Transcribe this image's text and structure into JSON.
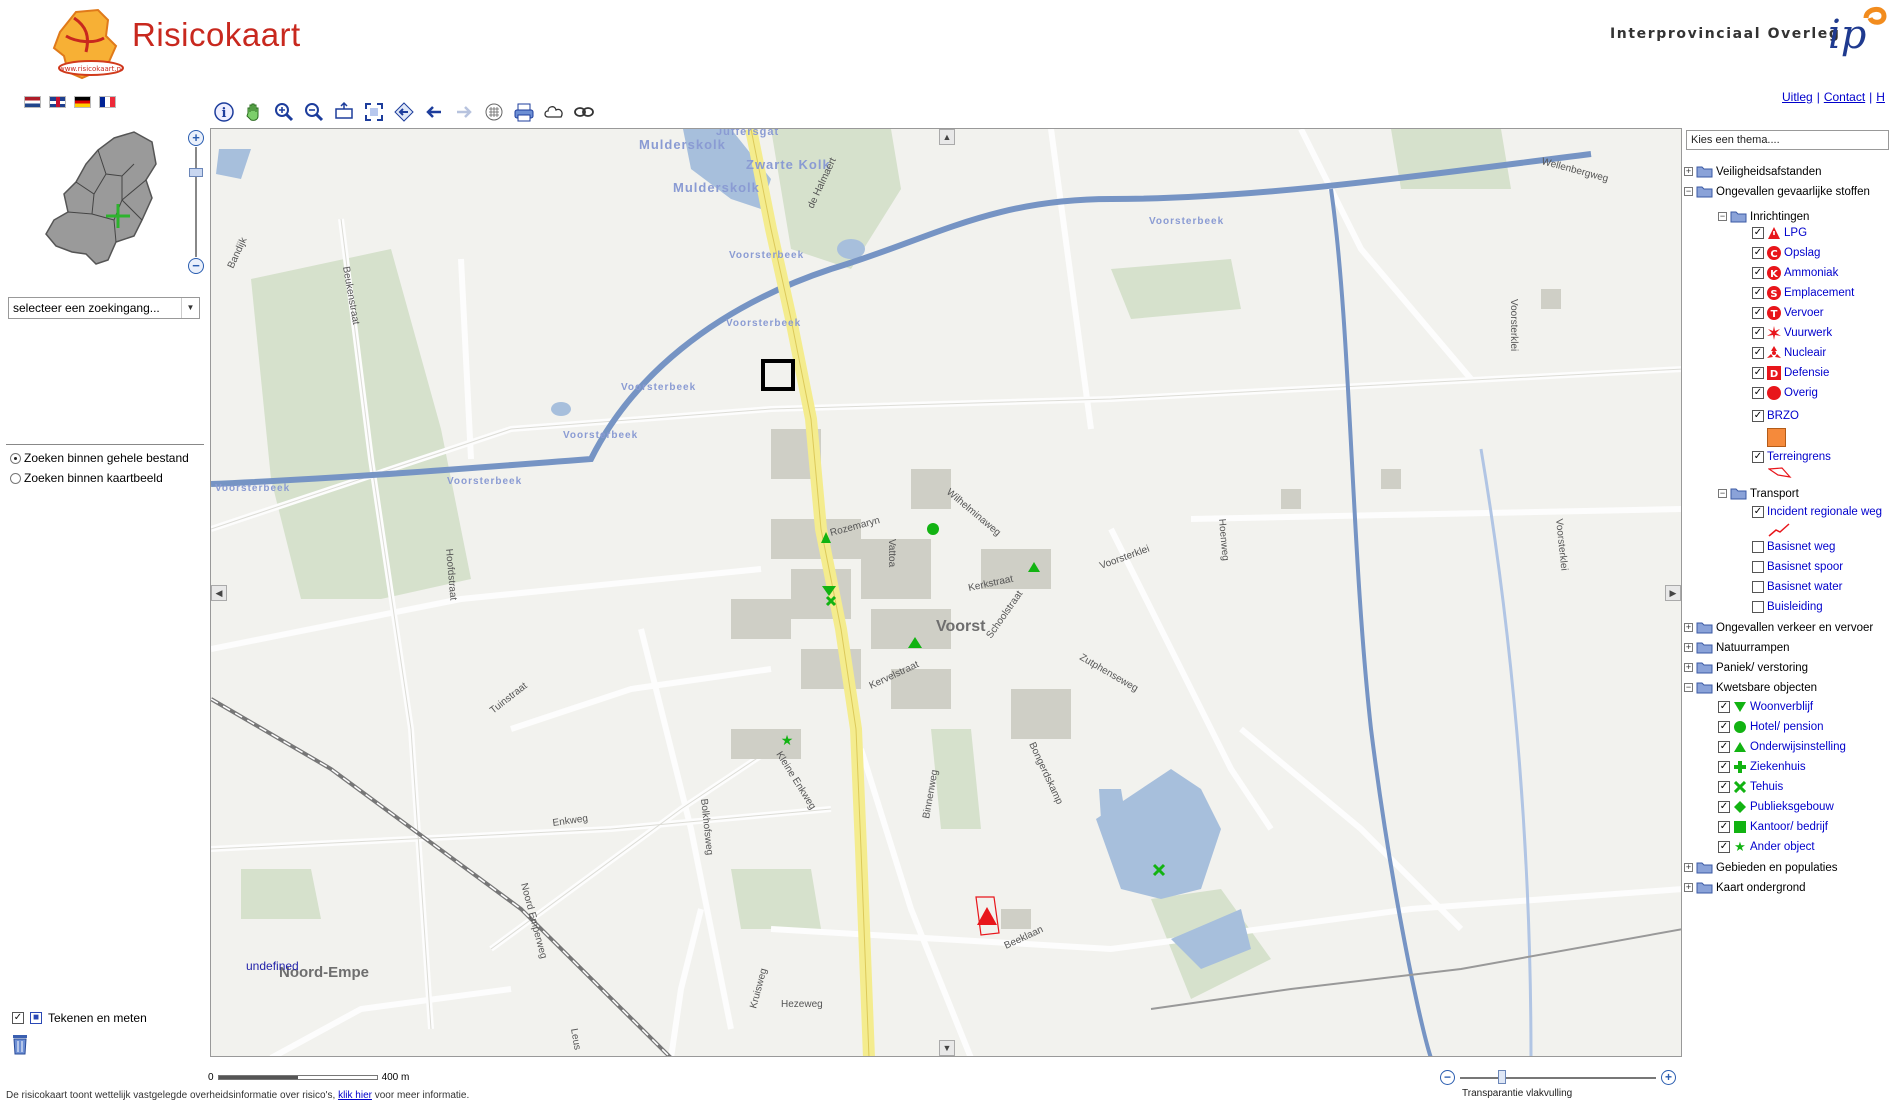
{
  "header": {
    "title": "Risicokaart",
    "logo_url_text": "www.risicokaart.nl",
    "org_name": "Interprovinciaal Overleg",
    "org_logo_text": "ip",
    "links": [
      "Uitleg",
      "Contact"
    ]
  },
  "languages": [
    "Nederlands",
    "English",
    "Deutsch",
    "Français"
  ],
  "search": {
    "dropdown_value": "selecteer  een zoekingang...",
    "options": [
      "Zoeken binnen gehele bestand",
      "Zoeken binnen kaartbeeld"
    ],
    "selected": 0
  },
  "draw": {
    "label": "Tekenen en meten"
  },
  "map": {
    "labels": {
      "undefined": "undefined",
      "jufferstgat": "Juffersgat",
      "mulderskolk1": "Mulderskolk",
      "zwarte_kolk": "Zwarte Kolk",
      "mulderskolk2": "Mulderskolk",
      "voorsterbeek": "Voorsterbeek",
      "voorst": "Voorst",
      "noord_empe": "Noord-Empe",
      "wellenbergweg": "Wellenbergweg",
      "voorsterklei": "Voorsterklei",
      "bandijk": "Bandijk",
      "beukenstraat": "Beukenstraat",
      "hoofdstraat": "Hoofdstraat",
      "tuinstraat": "Tuinstraat",
      "enkweg": "Enkweg",
      "kleine_enkweg": "Kleine Enkweg",
      "bolkhofsweg": "Bolkhofsweg",
      "noord_emperweg": "Noord Emperweg",
      "hezeweg": "Hezeweg",
      "kruisweg": "Kruisweg",
      "leus": "Leus",
      "binnenweg": "Binnenweg",
      "beeklaan": "Beeklaan",
      "bongerdskamp": "Bongerdskamp",
      "zutphenseweg": "Zutphenseweg",
      "schoolstraat": "Schoolstraat",
      "kerkstraat": "Kerkstraat",
      "wilhelminaweg": "Wilhelminaweg",
      "rozemaryn": "Rozemaryn",
      "kervelstraat": "Kervelstraat",
      "hoenweg": "Hoenweg",
      "de_halmaert": "de Halmaert",
      "vattoa": "Vattoa",
      "ewsweg": "Ewsweg"
    }
  },
  "scalebar": {
    "start": "0",
    "end": "400 m"
  },
  "transparency": {
    "label": "Transparantie vlakvulling"
  },
  "footer": {
    "text_before": "De risicokaart toont wettelijk vastgelegde overheidsinformatie over risico's,",
    "link": "klik hier",
    "text_after": "voor meer informatie."
  },
  "legend": {
    "theme_placeholder": "Kies een thema....",
    "top_level": [
      "Veiligheidsafstanden",
      "Ongevallen gevaarlijke stoffen",
      "Ongevallen verkeer en vervoer",
      "Natuurrampen",
      "Paniek/ verstoring",
      "Kwetsbare objecten",
      "Gebieden en populaties",
      "Kaart ondergrond"
    ],
    "inrichtingen": "Inrichtingen",
    "inrichtingen_items": [
      "LPG",
      "Opslag",
      "Ammoniak",
      "Emplacement",
      "Vervoer",
      "Vuurwerk",
      "Nucleair",
      "Defensie",
      "Overig"
    ],
    "inrichtingen_letters": [
      "",
      "C",
      "K",
      "S",
      "T",
      "",
      "",
      "D",
      ""
    ],
    "brzo": "BRZO",
    "terreingrens": "Terreingrens",
    "transport": "Transport",
    "transport_items": [
      "Incident regionale weg",
      "Basisnet weg",
      "Basisnet spoor",
      "Basisnet water",
      "Buisleiding"
    ],
    "kwetsbare_items": [
      "Woonverblijf",
      "Hotel/ pension",
      "Onderwijsinstelling",
      "Ziekenhuis",
      "Tehuis",
      "Publieksgebouw",
      "Kantoor/ bedrijf",
      "Ander object"
    ],
    "colors": {
      "risk_red": "#e8161b",
      "kwetsbaar_green": "#12b312",
      "brzo_orange": "#f58a3b"
    }
  }
}
